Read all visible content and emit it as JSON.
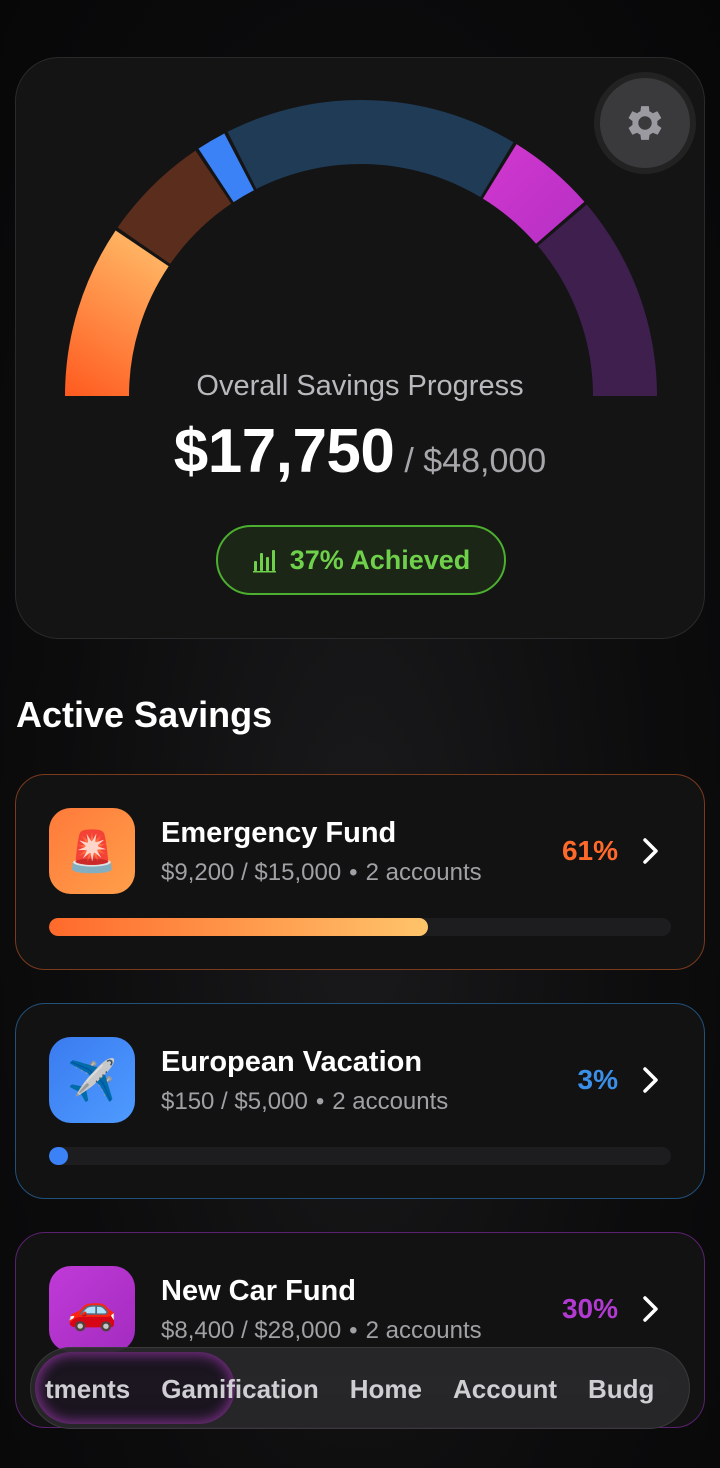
{
  "hero": {
    "label": "Overall Savings Progress",
    "current": "$17,750",
    "total": "/ $48,000",
    "achieved": "37% Achieved",
    "progress_fraction": 0.37,
    "settings_icon": "gear-icon",
    "achieved_icon": "bar-chart-icon"
  },
  "section_title": "Active Savings",
  "goals": [
    {
      "name": "Emergency Fund",
      "icon": "🚨",
      "icon_name": "siren-icon",
      "sub_amount": "$9,200 / $15,000",
      "sub_accounts": "2 accounts",
      "percent": "61%",
      "progress": 0.61,
      "color": "#ff6a2b"
    },
    {
      "name": "European Vacation",
      "icon": "✈️",
      "icon_name": "airplane-icon",
      "sub_amount": "$150 / $5,000",
      "sub_accounts": "2 accounts",
      "percent": "3%",
      "progress": 0.03,
      "color": "#3b8fe6"
    },
    {
      "name": "New Car Fund",
      "icon": "🚗",
      "icon_name": "car-icon",
      "sub_amount": "$8,400 / $28,000",
      "sub_accounts": "2 accounts",
      "percent": "30%",
      "progress": 0.3,
      "color": "#b13ad0"
    }
  ],
  "nav": {
    "items": [
      "tments",
      "Gamification",
      "Home",
      "Account",
      "Budg"
    ]
  },
  "colors": {
    "orange": "#ff6a2b",
    "blue": "#3b8fe6",
    "purple": "#b13ad0",
    "green": "#6fd04b"
  }
}
